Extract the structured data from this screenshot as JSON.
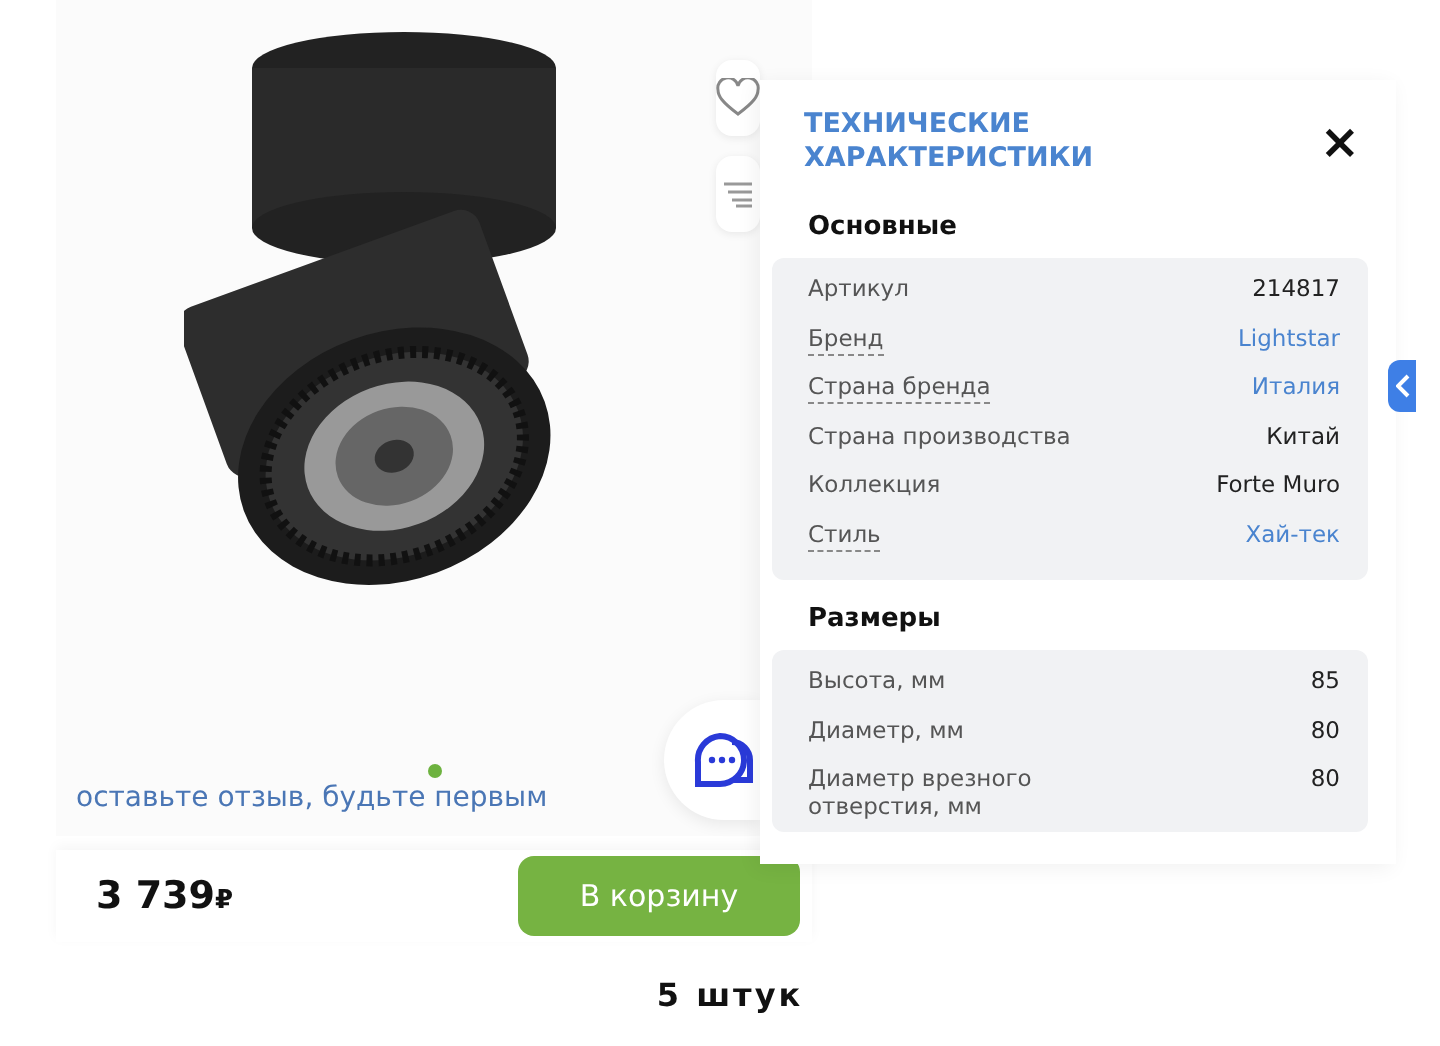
{
  "product": {
    "review_link": "оставьте отзыв, будьте первым",
    "gallery_dots": [
      {
        "selected": true
      }
    ],
    "price": "3 739",
    "currency": "₽",
    "cart_button": "В корзину"
  },
  "specs_panel": {
    "title": "ТЕХНИЧЕСКИЕ ХАРАКТЕРИСТИКИ",
    "close": "×",
    "groups": [
      {
        "title": "Основные",
        "rows": [
          {
            "label": "Артикул",
            "value": "214817",
            "hint": false,
            "link": false
          },
          {
            "label": "Бренд",
            "value": "Lightstar",
            "hint": true,
            "link": true
          },
          {
            "label": "Страна бренда",
            "value": "Италия",
            "hint": true,
            "link": true
          },
          {
            "label": "Страна производства",
            "value": "Китай",
            "hint": false,
            "link": false
          },
          {
            "label": "Коллекция",
            "value": "Forte Muro",
            "hint": false,
            "link": false
          },
          {
            "label": "Стиль",
            "value": "Хай-тек",
            "hint": true,
            "link": true
          }
        ]
      },
      {
        "title": "Размеры",
        "rows": [
          {
            "label": "Высота, мм",
            "value": "85",
            "hint": false,
            "link": false
          },
          {
            "label": "Диаметр, мм",
            "value": "80",
            "hint": false,
            "link": false
          },
          {
            "label": "Диаметр врезного отверстия, мм",
            "value": "80",
            "hint": false,
            "link": false
          }
        ]
      }
    ]
  },
  "caption": "5 штук"
}
